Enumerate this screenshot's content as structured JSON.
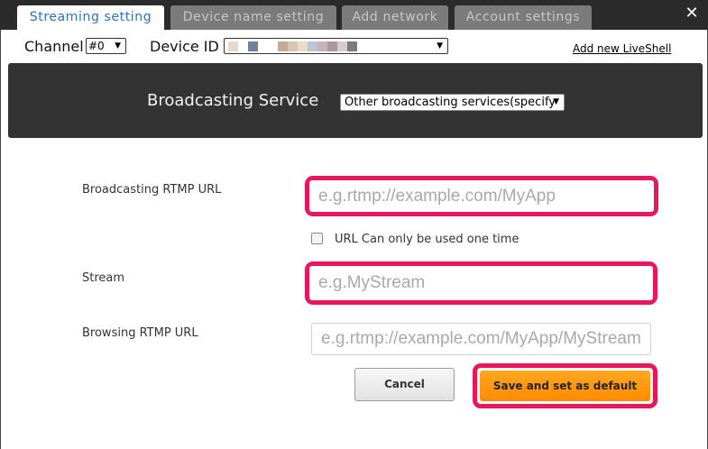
{
  "tabs": [
    {
      "label": "Streaming setting",
      "active": true
    },
    {
      "label": "Device name setting",
      "active": false
    },
    {
      "label": "Add network",
      "active": false
    },
    {
      "label": "Account settings",
      "active": false
    }
  ],
  "close_icon": "close-icon",
  "channel": {
    "label": "Channel",
    "selected": "#0"
  },
  "device_id": {
    "label": "Device ID",
    "swatch_colors": [
      "#e8d9c6",
      "#ffffff",
      "#6e82a0",
      "#ffffff",
      "#ffffff",
      "#c4ab91",
      "#dcc6b0",
      "#e7dcc7",
      "#b8c7d6",
      "#c8b3bc",
      "#a89a9f",
      "#d7cbd0",
      "#7b7b7b"
    ]
  },
  "add_link": "Add new LiveShell",
  "service": {
    "label": "Broadcasting Service",
    "selected": "Other broadcasting services(specify"
  },
  "form": {
    "rtmp_url": {
      "label": "Broadcasting RTMP URL",
      "placeholder": "e.g.rtmp://example.com/MyApp",
      "value": ""
    },
    "one_time": {
      "label": "URL Can only be used one time",
      "checked": false
    },
    "stream": {
      "label": "Stream",
      "placeholder": "e.g.MyStream",
      "value": ""
    },
    "browsing_url": {
      "label": "Browsing RTMP URL",
      "placeholder": "e.g.rtmp://example.com/MyApp/MyStream",
      "value": ""
    }
  },
  "buttons": {
    "cancel": "Cancel",
    "save": "Save and set as default"
  },
  "colors": {
    "highlight": "#e8175d",
    "save_button": "#ff9a10",
    "active_tab_text": "#2a72c3",
    "panel": "#333333"
  }
}
